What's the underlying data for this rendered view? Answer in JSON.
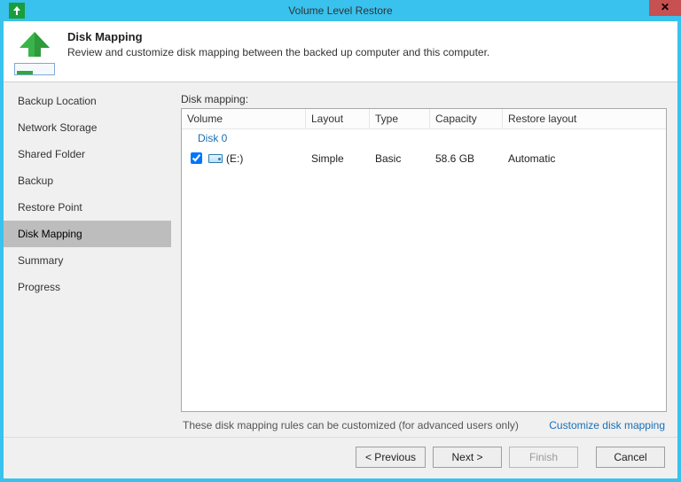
{
  "window": {
    "title": "Volume Level Restore"
  },
  "header": {
    "title": "Disk Mapping",
    "subtitle": "Review and customize disk mapping between the backed up computer and this computer."
  },
  "sidebar": {
    "items": [
      {
        "label": "Backup Location",
        "active": false
      },
      {
        "label": "Network Storage",
        "active": false
      },
      {
        "label": "Shared Folder",
        "active": false
      },
      {
        "label": "Backup",
        "active": false
      },
      {
        "label": "Restore Point",
        "active": false
      },
      {
        "label": "Disk Mapping",
        "active": true
      },
      {
        "label": "Summary",
        "active": false
      },
      {
        "label": "Progress",
        "active": false
      }
    ]
  },
  "main": {
    "label": "Disk mapping:",
    "columns": {
      "volume": "Volume",
      "layout": "Layout",
      "type": "Type",
      "capacity": "Capacity",
      "restore_layout": "Restore layout"
    },
    "group": "Disk 0",
    "row": {
      "checked": true,
      "volume": "(E:)",
      "layout": "Simple",
      "type": "Basic",
      "capacity": "58.6 GB",
      "restore_layout": "Automatic"
    },
    "hint": "These disk mapping rules can be customized (for advanced users only)",
    "link": "Customize disk mapping"
  },
  "footer": {
    "previous": "< Previous",
    "next": "Next >",
    "finish": "Finish",
    "cancel": "Cancel"
  }
}
